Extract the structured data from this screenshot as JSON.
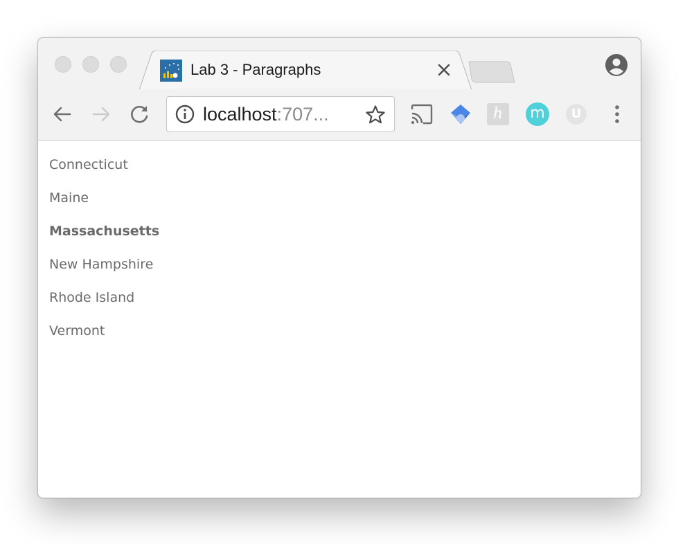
{
  "tab": {
    "title": "Lab 3 - Paragraphs",
    "favicon": "chart-favicon-icon"
  },
  "address_bar": {
    "host": "localhost",
    "rest": ":707..."
  },
  "toolbar": {
    "icons": [
      "back-arrow-icon",
      "forward-arrow-icon",
      "reload-icon",
      "cast-icon",
      "extension-diamond-icon",
      "extension-h-icon",
      "extension-m-icon",
      "extension-u-icon",
      "menu-kebab-icon"
    ],
    "m_extension_label": "m",
    "h_extension_label": "h",
    "u_extension_label": "U"
  },
  "colors": {
    "text": "#6b6b6b",
    "m_extension": "#4fd1d9",
    "h_extension": "#d9d9d9"
  },
  "content": {
    "paragraphs": [
      {
        "text": "Connecticut",
        "bold": false
      },
      {
        "text": "Maine",
        "bold": false
      },
      {
        "text": "Massachusetts",
        "bold": true
      },
      {
        "text": "New Hampshire",
        "bold": false
      },
      {
        "text": "Rhode Island",
        "bold": false
      },
      {
        "text": "Vermont",
        "bold": false
      }
    ]
  }
}
